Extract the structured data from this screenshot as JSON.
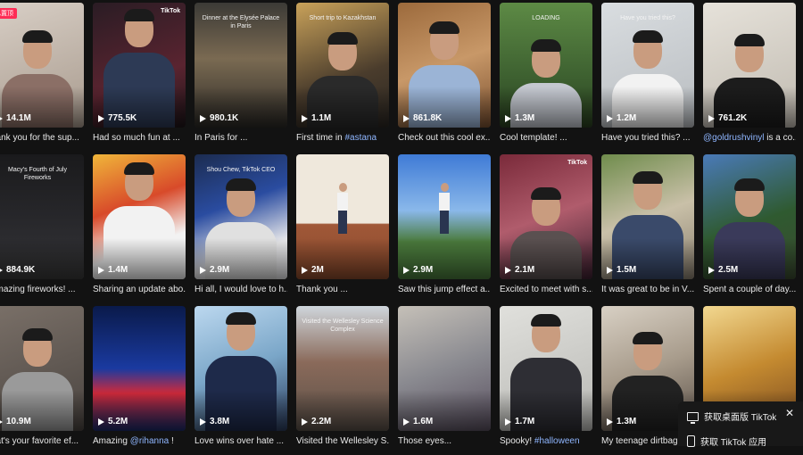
{
  "pinned_label": "已置顶",
  "videos": [
    {
      "views": "14.1M",
      "desc": "hank you for the sup...",
      "bg": "linear-gradient(160deg,#d8cfc6,#a89a8d)",
      "shirt": "#8b6f66",
      "headTop": 34,
      "pinned": true
    },
    {
      "views": "775.5K",
      "desc": "Had so much fun at ...",
      "bg": "linear-gradient(160deg,#2a1c24,#5a2430 60%,#1c1418)",
      "shirt": "#2d3a55",
      "headTop": 10,
      "watermark": "TikTok"
    },
    {
      "views": "980.1K",
      "desc": "In Paris for ...",
      "bg": "linear-gradient(180deg,#3b3a36,#7a6a52 45%,#2c2a26)",
      "shirt": null,
      "overlay": "Dinner at the Elysée Palace in Paris"
    },
    {
      "views": "1.1M",
      "desc": "First time in ",
      "tag": "#astana",
      "bg": "linear-gradient(160deg,#c9a25a,#4a3c2c 60%,#2a2622)",
      "shirt": "#2a2a2a",
      "headTop": 36,
      "overlay": "Short trip to Kazakhstan"
    },
    {
      "views": "861.8K",
      "desc": "Check out this cool ex...",
      "bg": "linear-gradient(160deg,#9c6a3c,#c89868 50%,#7a5030)",
      "shirt": "#9bb4d6",
      "headTop": 24
    },
    {
      "views": "1.3M",
      "desc": "Cool template! ...",
      "bg": "linear-gradient(180deg,#5d8a45,#3d6030 60%,#2a4020)",
      "shirt": "#c4c8d0",
      "headTop": 44,
      "overlay": "LOADING"
    },
    {
      "views": "1.2M",
      "desc": "Have you tried this? ...",
      "bg": "linear-gradient(160deg,#d9dde0,#b8bcc0)",
      "shirt": "#f2f2f2",
      "headTop": 34,
      "overlay": "Have you tried this?"
    },
    {
      "views": "761.2K",
      "desc": "",
      "tag": "@goldrushvinyl",
      "desc2": " is a co...",
      "bg": "linear-gradient(160deg,#e6e2da,#c0bab0)",
      "shirt": "#1c1c1c",
      "headTop": 38
    },
    {
      "views": "884.9K",
      "desc": "amazing fireworks! ...",
      "bg": "linear-gradient(180deg,#1a1a1c,#2c2c30 70%,#3a3a3a)",
      "shirt": null,
      "overlay": "Macy's Fourth of July Fireworks"
    },
    {
      "views": "1.4M",
      "desc": "Sharing an update abo...",
      "bg": "linear-gradient(160deg,#f0b63a,#d84a2a 40%,#f2f2f2 70%)",
      "shirt": "#f2f2f2",
      "headTop": 12
    },
    {
      "views": "2.9M",
      "desc": "Hi all, I would love to h...",
      "bg": "linear-gradient(160deg,#1c2c50,#2a4ca0 40%,#e8e8ea 75%)",
      "shirt": "#e0e0e0",
      "headTop": 30,
      "overlay": "Shou Chew, TikTok CEO"
    },
    {
      "views": "2M",
      "desc": "Thank you ...",
      "bg": "linear-gradient(180deg,#efe8dc 55%,#a05838 56%,#8a4a2c)",
      "shirt": null,
      "standing": true
    },
    {
      "views": "2.9M",
      "desc": "Saw this jump effect a...",
      "bg": "linear-gradient(180deg,#3f7bd6,#8ab8ea 45%,#4a7a3c 70%)",
      "shirt": null,
      "standing": true
    },
    {
      "views": "2.1M",
      "desc": "Excited to meet with s...",
      "bg": "linear-gradient(160deg,#7a2a3a,#b05c6c 50%,#3c2030)",
      "shirt": "#5a5050",
      "headTop": 40,
      "watermark": "TikTok"
    },
    {
      "views": "1.5M",
      "desc": "It was great to be in V...",
      "bg": "linear-gradient(160deg,#6f8c4c,#c9c0a8 50%,#8a8070)",
      "shirt": "#3a4a6a",
      "headTop": 22
    },
    {
      "views": "2.5M",
      "desc": "Spent a couple of day...",
      "bg": "linear-gradient(160deg,#4a7ab8,#2f5a30 55%,#3a4a30)",
      "shirt": "#3a3a5a",
      "headTop": 30
    },
    {
      "views": "10.9M",
      "desc": "nat's your favorite ef...",
      "bg": "linear-gradient(160deg,#7a7068,#4a4440)",
      "shirt": "#9a9a9a",
      "headTop": 28
    },
    {
      "views": "5.2M",
      "desc": "Amazing ",
      "tag": "@rihanna",
      "desc2": " !",
      "bg": "linear-gradient(180deg,#0a1a4a,#1a3aa0 50%,#d02a3a 70%,#1a2a6a)",
      "shirt": null
    },
    {
      "views": "3.8M",
      "desc": "Love wins over hate ...",
      "bg": "linear-gradient(160deg,#bcd8ef,#7aa6c8 50%,#2a3a5a)",
      "shirt": "#1e2a4a",
      "headTop": 10
    },
    {
      "views": "2.2M",
      "desc": "Visited the Wellesley S...",
      "bg": "linear-gradient(180deg,#cfd6dc,#8a6a5a 45%,#5a5048)",
      "shirt": null,
      "overlay": "Visited the Wellesley Science Complex"
    },
    {
      "views": "1.6M",
      "desc": "Those eyes... ",
      "bg": "linear-gradient(160deg,#c5c0b8,#8a8a90 50%,#5a5060)",
      "shirt": null
    },
    {
      "views": "1.7M",
      "desc": "Spooky! ",
      "tag": "#halloween",
      "bg": "linear-gradient(160deg,#e0e0dc,#b8b8b4)",
      "shirt": "#2e2e34",
      "headTop": 12
    },
    {
      "views": "1.3M",
      "desc": "My teenage dirtbag ...",
      "bg": "linear-gradient(160deg,#d8d0c4,#a89c8c 50%,#5a5048)",
      "shirt": "#222",
      "headTop": 32
    },
    {
      "views": "",
      "desc": "",
      "bg": "linear-gradient(160deg,#f2d890,#c48a30 50%,#7a4a20)",
      "shirt": null
    }
  ],
  "download_panel": {
    "desktop_label": "获取桌面版 TikTok",
    "app_label": "获取 TikTok 应用",
    "close_symbol": "✕"
  }
}
